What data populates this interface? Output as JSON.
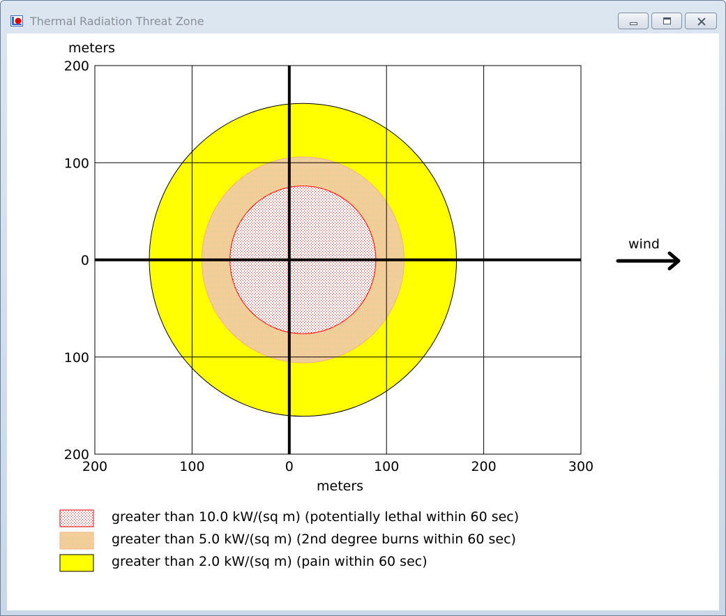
{
  "window": {
    "title": "Thermal Radiation Threat Zone",
    "icon": "threat-zone-app-icon",
    "controls": [
      "minimize",
      "maximize",
      "close"
    ]
  },
  "colors": {
    "zone_red": "#ff0000",
    "zone_orange_fill": "#fcd9a8",
    "zone_yellow": "#ffff00",
    "grid": "#000000",
    "background": "#ffffff"
  },
  "chart_data": {
    "type": "area",
    "title": "",
    "xlabel": "meters",
    "ylabel": "meters",
    "xlim": [
      -200,
      300
    ],
    "ylim": [
      -200,
      200
    ],
    "x_ticks": [
      {
        "value": -200,
        "label": "200"
      },
      {
        "value": -100,
        "label": "100"
      },
      {
        "value": 0,
        "label": "0"
      },
      {
        "value": 100,
        "label": "100"
      },
      {
        "value": 200,
        "label": "200"
      },
      {
        "value": 300,
        "label": "300"
      }
    ],
    "y_ticks": [
      {
        "value": 200,
        "label": "200"
      },
      {
        "value": 100,
        "label": "100"
      },
      {
        "value": 0,
        "label": "0"
      },
      {
        "value": -100,
        "label": "100"
      },
      {
        "value": -200,
        "label": "200"
      }
    ],
    "grid": true,
    "series": [
      {
        "name": "greater than 2.0 kW/(sq m) (pain within 60 sec)",
        "shape": "ellipse",
        "center_x": 14,
        "center_y": 0,
        "radius_x": 158,
        "radius_y": 161,
        "fill": "#ffff00",
        "stroke": "#000000",
        "pattern": "solid"
      },
      {
        "name": "greater than 5.0 kW/(sq m) (2nd degree burns within 60 sec)",
        "shape": "ellipse",
        "center_x": 14,
        "center_y": 0,
        "radius_x": 104,
        "radius_y": 106,
        "fill": "#fcd9a8",
        "stroke": "#f4b183",
        "pattern": "dense-dots"
      },
      {
        "name": "greater than 10.0 kW/(sq m) (potentially lethal within 60 sec)",
        "shape": "ellipse",
        "center_x": 14,
        "center_y": 0,
        "radius_x": 75,
        "radius_y": 76,
        "fill": "#ffffff",
        "stroke": "#ff0000",
        "pattern": "red-dots"
      }
    ],
    "legend": {
      "placement": "bottom-left",
      "entries": [
        {
          "label": "greater than 10.0 kW/(sq m) (potentially lethal within 60 sec)",
          "swatch": "red-dots"
        },
        {
          "label": "greater than 5.0 kW/(sq m) (2nd degree burns within 60 sec)",
          "swatch": "orange-dots"
        },
        {
          "label": "greater than 2.0 kW/(sq m) (pain within 60 sec)",
          "swatch": "yellow-solid"
        }
      ]
    },
    "annotations": [
      {
        "text": "wind",
        "icon": "wind-arrow-icon",
        "direction": "right"
      }
    ]
  }
}
